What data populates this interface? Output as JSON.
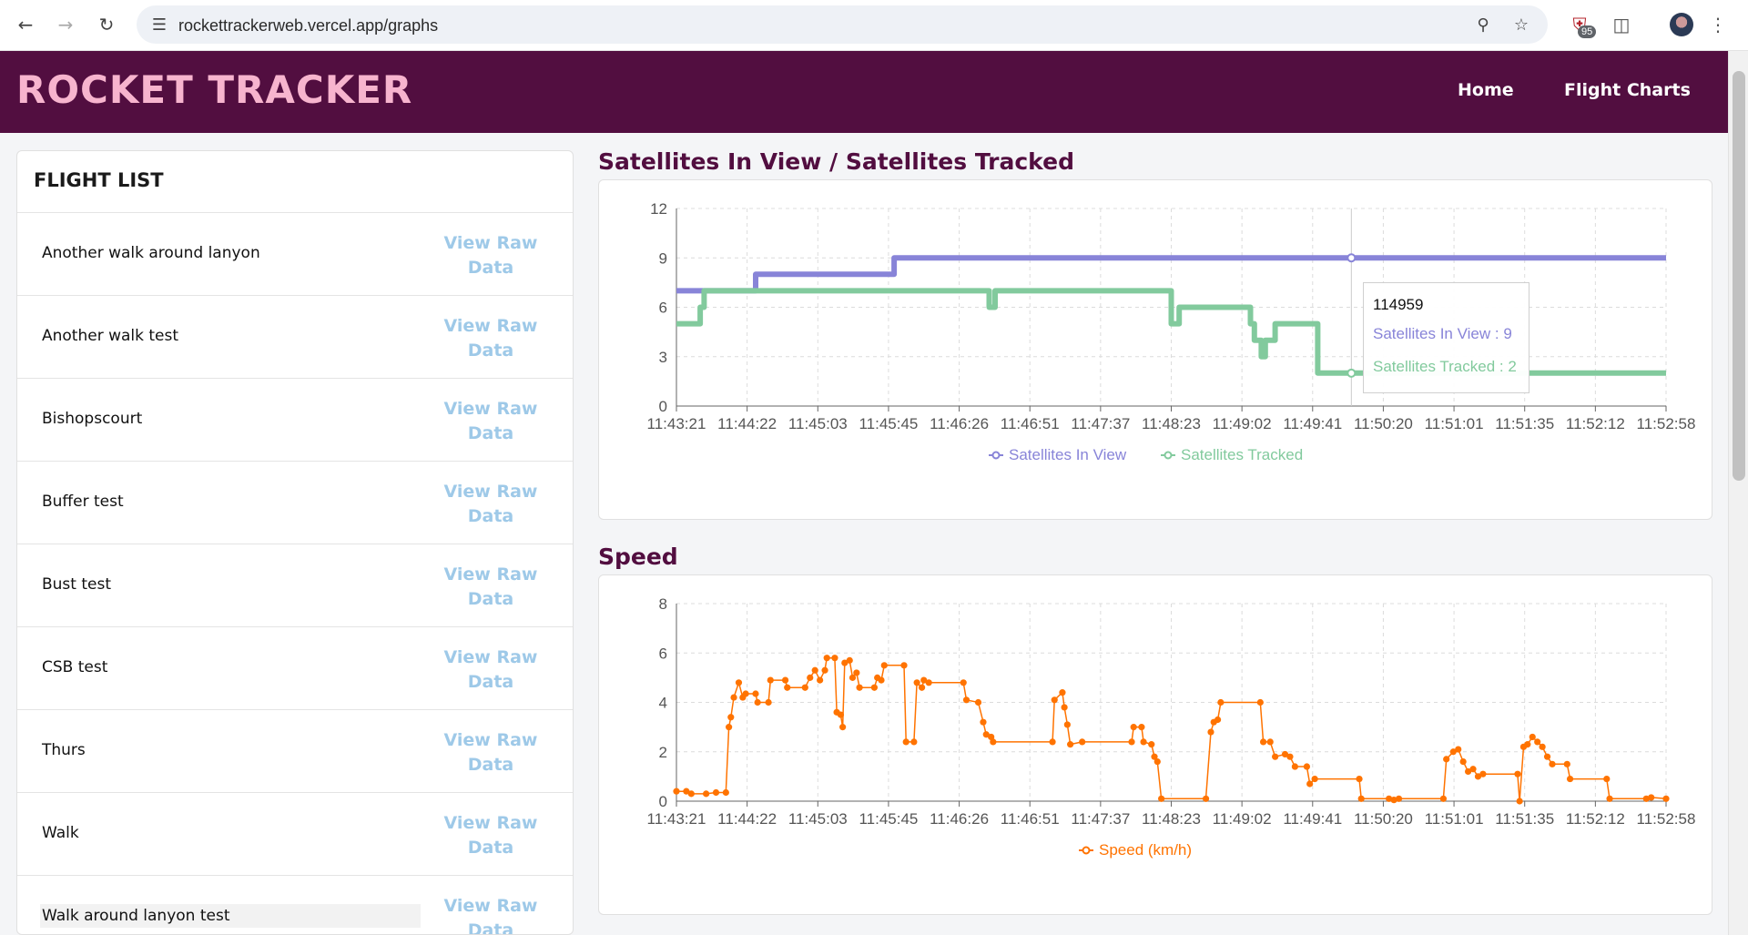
{
  "browser": {
    "url": "rockettrackerweb.vercel.app/graphs",
    "extension_badge": "95"
  },
  "header": {
    "brand": "ROCKET TRACKER",
    "nav": [
      {
        "label": "Home"
      },
      {
        "label": "Flight Charts"
      }
    ]
  },
  "flight_list": {
    "title": "FLIGHT LIST",
    "link_line1": "View Raw",
    "link_line2": "Data",
    "items": [
      {
        "name": "Another walk around lanyon"
      },
      {
        "name": "Another walk test"
      },
      {
        "name": "Bishopscourt"
      },
      {
        "name": "Buffer test"
      },
      {
        "name": "Bust test"
      },
      {
        "name": "CSB test"
      },
      {
        "name": "Thurs"
      },
      {
        "name": "Walk"
      },
      {
        "name": "Walk around lanyon test"
      }
    ]
  },
  "colors": {
    "satellites_in_view": "#8884d8",
    "satellites_tracked": "#82ca9d",
    "speed": "#ff7300",
    "header_bg": "#520e40",
    "brand": "#f7b4ce"
  },
  "chart_data": [
    {
      "type": "line",
      "title": "Satellites In View / Satellites Tracked",
      "xlabel": "",
      "ylabel": "",
      "x_ticks": [
        "11:43:21",
        "11:44:22",
        "11:45:03",
        "11:45:45",
        "11:46:26",
        "11:46:51",
        "11:47:37",
        "11:48:23",
        "11:49:02",
        "11:49:41",
        "11:50:20",
        "11:51:01",
        "11:51:35",
        "11:52:12",
        "11:52:58"
      ],
      "y_ticks": [
        0,
        3,
        6,
        9,
        12
      ],
      "ylim": [
        0,
        12
      ],
      "grid": true,
      "legend": "bottom",
      "tooltip": {
        "label": "114959",
        "lines": [
          "Satellites In View : 9",
          "Satellites Tracked : 2"
        ]
      },
      "series": [
        {
          "name": "Satellites In View",
          "steps": [
            [
              0,
              7
            ],
            [
              0.08,
              7
            ],
            [
              0.08,
              8
            ],
            [
              0.22,
              8
            ],
            [
              0.22,
              9
            ],
            [
              1.0,
              9
            ]
          ]
        },
        {
          "name": "Satellites Tracked",
          "steps": [
            [
              0,
              5
            ],
            [
              0.024,
              5
            ],
            [
              0.024,
              6
            ],
            [
              0.028,
              6
            ],
            [
              0.028,
              7
            ],
            [
              0.316,
              7
            ],
            [
              0.316,
              6
            ],
            [
              0.322,
              6
            ],
            [
              0.322,
              7
            ],
            [
              0.5,
              7
            ],
            [
              0.5,
              5
            ],
            [
              0.508,
              5
            ],
            [
              0.508,
              6
            ],
            [
              0.58,
              6
            ],
            [
              0.58,
              5
            ],
            [
              0.584,
              5
            ],
            [
              0.584,
              4
            ],
            [
              0.591,
              4
            ],
            [
              0.591,
              3
            ],
            [
              0.595,
              3
            ],
            [
              0.595,
              4
            ],
            [
              0.605,
              4
            ],
            [
              0.605,
              5
            ],
            [
              0.648,
              5
            ],
            [
              0.648,
              2
            ],
            [
              1.0,
              2
            ]
          ]
        }
      ]
    },
    {
      "type": "line",
      "title": "Speed",
      "xlabel": "",
      "ylabel": "",
      "x_ticks": [
        "11:43:21",
        "11:44:22",
        "11:45:03",
        "11:45:45",
        "11:46:26",
        "11:46:51",
        "11:47:37",
        "11:48:23",
        "11:49:02",
        "11:49:41",
        "11:50:20",
        "11:51:01",
        "11:51:35",
        "11:52:12",
        "11:52:58"
      ],
      "y_ticks": [
        0,
        2,
        4,
        6,
        8
      ],
      "ylim": [
        0,
        8
      ],
      "grid": true,
      "legend": "bottom",
      "series": [
        {
          "name": "Speed (km/h)",
          "points": [
            [
              0,
              0.4
            ],
            [
              0.01,
              0.4
            ],
            [
              0.015,
              0.3
            ],
            [
              0.03,
              0.3
            ],
            [
              0.04,
              0.35
            ],
            [
              0.05,
              0.35
            ],
            [
              0.053,
              3.0
            ],
            [
              0.055,
              3.4
            ],
            [
              0.058,
              4.2
            ],
            [
              0.063,
              4.8
            ],
            [
              0.067,
              4.2
            ],
            [
              0.07,
              4.35
            ],
            [
              0.08,
              4.35
            ],
            [
              0.082,
              4.0
            ],
            [
              0.093,
              4.0
            ],
            [
              0.095,
              4.9
            ],
            [
              0.11,
              4.9
            ],
            [
              0.112,
              4.6
            ],
            [
              0.13,
              4.6
            ],
            [
              0.135,
              5.0
            ],
            [
              0.14,
              5.3
            ],
            [
              0.145,
              4.9
            ],
            [
              0.15,
              5.3
            ],
            [
              0.152,
              5.8
            ],
            [
              0.16,
              5.8
            ],
            [
              0.162,
              3.6
            ],
            [
              0.166,
              3.5
            ],
            [
              0.168,
              3.0
            ],
            [
              0.17,
              5.6
            ],
            [
              0.175,
              5.7
            ],
            [
              0.178,
              5.0
            ],
            [
              0.182,
              5.2
            ],
            [
              0.185,
              4.6
            ],
            [
              0.2,
              4.6
            ],
            [
              0.203,
              5.0
            ],
            [
              0.207,
              4.9
            ],
            [
              0.21,
              5.5
            ],
            [
              0.23,
              5.5
            ],
            [
              0.232,
              2.4
            ],
            [
              0.24,
              2.4
            ],
            [
              0.243,
              4.8
            ],
            [
              0.248,
              4.6
            ],
            [
              0.25,
              4.9
            ],
            [
              0.255,
              4.8
            ],
            [
              0.29,
              4.8
            ],
            [
              0.293,
              4.1
            ],
            [
              0.305,
              4.0
            ],
            [
              0.31,
              3.2
            ],
            [
              0.313,
              2.7
            ],
            [
              0.318,
              2.6
            ],
            [
              0.32,
              2.4
            ],
            [
              0.38,
              2.4
            ],
            [
              0.382,
              4.1
            ],
            [
              0.39,
              4.4
            ],
            [
              0.392,
              3.8
            ],
            [
              0.395,
              3.1
            ],
            [
              0.398,
              2.3
            ],
            [
              0.41,
              2.4
            ],
            [
              0.46,
              2.4
            ],
            [
              0.462,
              3.0
            ],
            [
              0.47,
              3.0
            ],
            [
              0.472,
              2.4
            ],
            [
              0.48,
              2.3
            ],
            [
              0.483,
              1.8
            ],
            [
              0.486,
              1.6
            ],
            [
              0.49,
              0.1
            ],
            [
              0.535,
              0.1
            ],
            [
              0.54,
              2.8
            ],
            [
              0.543,
              3.2
            ],
            [
              0.547,
              3.3
            ],
            [
              0.55,
              4.0
            ],
            [
              0.59,
              4.0
            ],
            [
              0.593,
              2.4
            ],
            [
              0.6,
              2.4
            ],
            [
              0.605,
              1.8
            ],
            [
              0.615,
              1.9
            ],
            [
              0.62,
              1.8
            ],
            [
              0.625,
              1.4
            ],
            [
              0.637,
              1.4
            ],
            [
              0.64,
              0.7
            ],
            [
              0.645,
              0.9
            ],
            [
              0.69,
              0.9
            ],
            [
              0.692,
              0.1
            ],
            [
              0.72,
              0.1
            ],
            [
              0.725,
              0.05
            ],
            [
              0.73,
              0.1
            ],
            [
              0.775,
              0.1
            ],
            [
              0.778,
              1.7
            ],
            [
              0.785,
              2.0
            ],
            [
              0.79,
              2.1
            ],
            [
              0.795,
              1.6
            ],
            [
              0.8,
              1.2
            ],
            [
              0.805,
              1.3
            ],
            [
              0.81,
              1.0
            ],
            [
              0.815,
              1.1
            ],
            [
              0.85,
              1.1
            ],
            [
              0.852,
              0.0
            ],
            [
              0.856,
              2.2
            ],
            [
              0.86,
              2.3
            ],
            [
              0.865,
              2.6
            ],
            [
              0.87,
              2.4
            ],
            [
              0.875,
              2.2
            ],
            [
              0.88,
              1.8
            ],
            [
              0.885,
              1.5
            ],
            [
              0.9,
              1.5
            ],
            [
              0.903,
              0.9
            ],
            [
              0.94,
              0.9
            ],
            [
              0.943,
              0.1
            ],
            [
              0.98,
              0.1
            ],
            [
              0.985,
              0.15
            ],
            [
              1.0,
              0.1
            ]
          ]
        }
      ]
    }
  ]
}
